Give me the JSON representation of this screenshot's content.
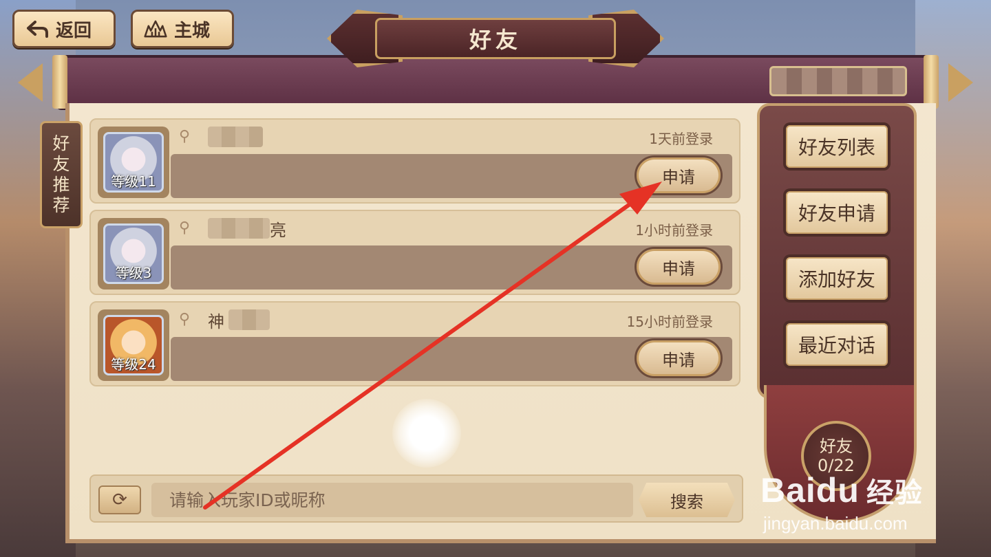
{
  "top_buttons": {
    "back_label": "返回",
    "city_label": "主城"
  },
  "title": "好友",
  "side_tab": {
    "chars": [
      "好",
      "友",
      "推",
      "荐"
    ]
  },
  "friends": [
    {
      "name": "",
      "level": "等级11",
      "last_login": "1天前登录",
      "apply_label": "申请"
    },
    {
      "name": "亮",
      "level": "等级3",
      "last_login": "1小时前登录",
      "apply_label": "申请"
    },
    {
      "name": "神",
      "level": "等级24",
      "last_login": "15小时前登录",
      "apply_label": "申请"
    }
  ],
  "menu": {
    "friend_list": "好友列表",
    "friend_requests": "好友申请",
    "add_friend": "添加好友",
    "recent_chats": "最近对话"
  },
  "friend_count": {
    "label": "好友",
    "value": "0/22"
  },
  "search": {
    "placeholder": "请输入玩家ID或昵称",
    "button_label": "搜索"
  },
  "watermark": {
    "brand": "Baidu",
    "brand_cn": "经验",
    "url": "jingyan.baidu.com"
  },
  "colors": {
    "accent_red": "#e53225",
    "parchment": "#f3e6cf",
    "frame_purple": "#6b3a4e"
  }
}
